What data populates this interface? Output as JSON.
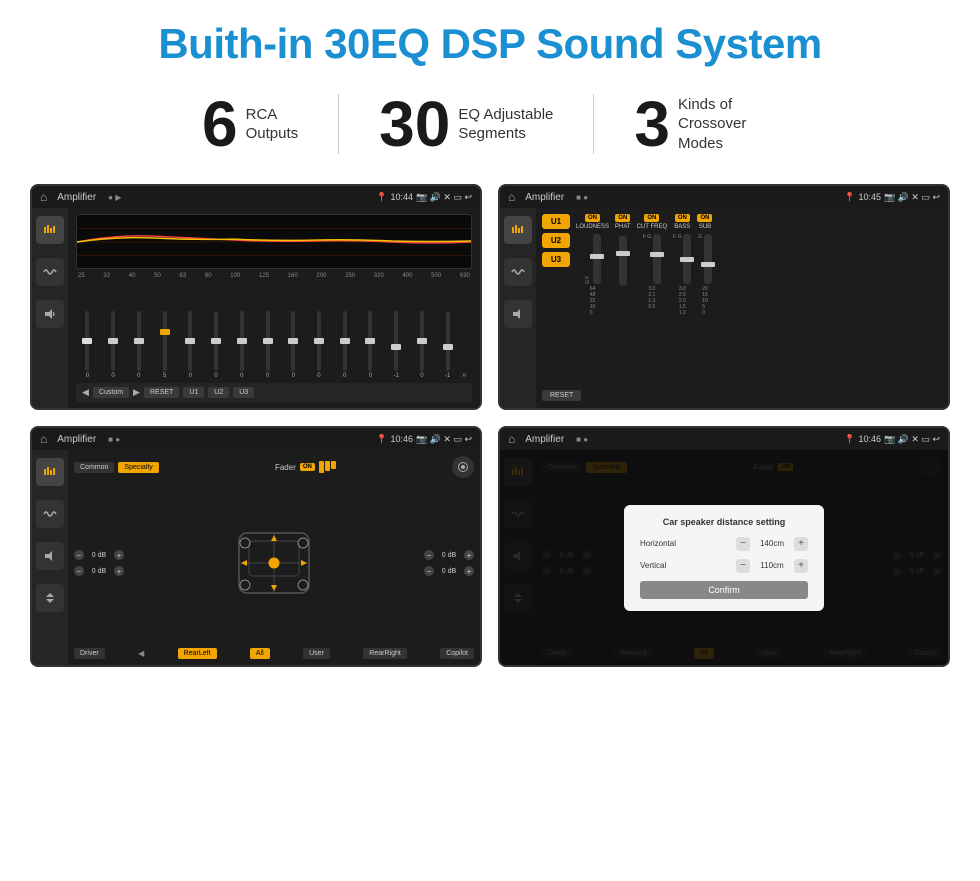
{
  "title": "Buith-in 30EQ DSP Sound System",
  "stats": [
    {
      "number": "6",
      "text_line1": "RCA",
      "text_line2": "Outputs"
    },
    {
      "number": "30",
      "text_line1": "EQ Adjustable",
      "text_line2": "Segments"
    },
    {
      "number": "3",
      "text_line1": "Kinds of",
      "text_line2": "Crossover Modes"
    }
  ],
  "screens": [
    {
      "id": "eq-screen",
      "status_bar": {
        "title": "Amplifier",
        "time": "10:44"
      },
      "type": "eq"
    },
    {
      "id": "crossover-screen",
      "status_bar": {
        "title": "Amplifier",
        "time": "10:45"
      },
      "type": "crossover"
    },
    {
      "id": "fader-screen",
      "status_bar": {
        "title": "Amplifier",
        "time": "10:46"
      },
      "type": "fader"
    },
    {
      "id": "dialog-screen",
      "status_bar": {
        "title": "Amplifier",
        "time": "10:46"
      },
      "type": "fader-dialog"
    }
  ],
  "eq": {
    "frequencies": [
      "25",
      "32",
      "40",
      "50",
      "63",
      "80",
      "100",
      "125",
      "160",
      "200",
      "250",
      "320",
      "400",
      "500",
      "630"
    ],
    "values": [
      "0",
      "0",
      "0",
      "5",
      "0",
      "0",
      "0",
      "0",
      "0",
      "0",
      "0",
      "0",
      "-1",
      "0",
      "-1"
    ],
    "presets": [
      "Custom",
      "RESET",
      "U1",
      "U2",
      "U3"
    ]
  },
  "crossover": {
    "presets": [
      "U1",
      "U2",
      "U3"
    ],
    "controls": [
      "LOUDNESS",
      "PHAT",
      "CUT FREQ",
      "BASS",
      "SUB"
    ],
    "control_values": [
      "ON",
      "ON",
      "ON",
      "ON",
      "ON"
    ],
    "reset_label": "RESET"
  },
  "fader": {
    "tabs": [
      "Common",
      "Specialty"
    ],
    "fader_label": "Fader",
    "fader_on": "ON",
    "db_values": [
      "0 dB",
      "0 dB",
      "0 dB",
      "0 dB"
    ],
    "bottom_btns": [
      "Driver",
      "RearLeft",
      "All",
      "User",
      "RearRight",
      "Copilot"
    ]
  },
  "dialog": {
    "title": "Car speaker distance setting",
    "horizontal_label": "Horizontal",
    "horizontal_value": "140cm",
    "vertical_label": "Vertical",
    "vertical_value": "110cm",
    "confirm_label": "Confirm"
  },
  "colors": {
    "accent": "#f0a500",
    "bg_dark": "#1c1c1c",
    "title_blue": "#1a8fd1"
  }
}
